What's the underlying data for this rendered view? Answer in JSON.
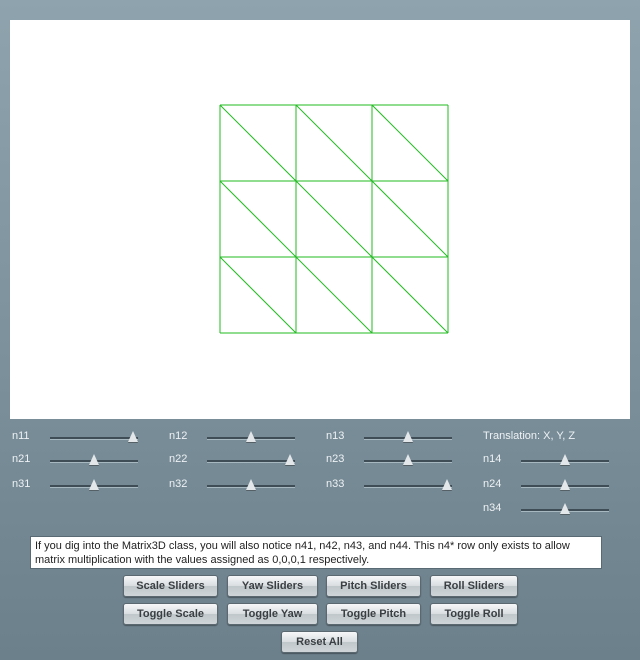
{
  "canvas": {
    "mesh_color": "#22bb22",
    "grid_cells": 3
  },
  "sliders": {
    "n11": {
      "label": "n11",
      "value": 1.0
    },
    "n12": {
      "label": "n12",
      "value": 0.5
    },
    "n13": {
      "label": "n13",
      "value": 0.5
    },
    "n21": {
      "label": "n21",
      "value": 0.5
    },
    "n22": {
      "label": "n22",
      "value": 1.0
    },
    "n23": {
      "label": "n23",
      "value": 0.5
    },
    "n31": {
      "label": "n31",
      "value": 0.5
    },
    "n32": {
      "label": "n32",
      "value": 0.5
    },
    "n33": {
      "label": "n33",
      "value": 1.0
    },
    "translation_label": "Translation: X, Y, Z",
    "n14": {
      "label": "n14",
      "value": 0.5
    },
    "n24": {
      "label": "n24",
      "value": 0.5
    },
    "n34": {
      "label": "n34",
      "value": 0.5
    }
  },
  "info_text": "If you dig into the Matrix3D class, you will also notice n41, n42, n43, and n44. This n4* row only exists to allow matrix multiplication with the values assigned as 0,0,0,1 respectively.",
  "buttons": {
    "scale_sliders": "Scale Sliders",
    "yaw_sliders": "Yaw Sliders",
    "pitch_sliders": "Pitch Sliders",
    "roll_sliders": "Roll Sliders",
    "toggle_scale": "Toggle Scale",
    "toggle_yaw": "Toggle Yaw",
    "toggle_pitch": "Toggle Pitch",
    "toggle_roll": "Toggle Roll",
    "reset_all": "Reset All"
  }
}
